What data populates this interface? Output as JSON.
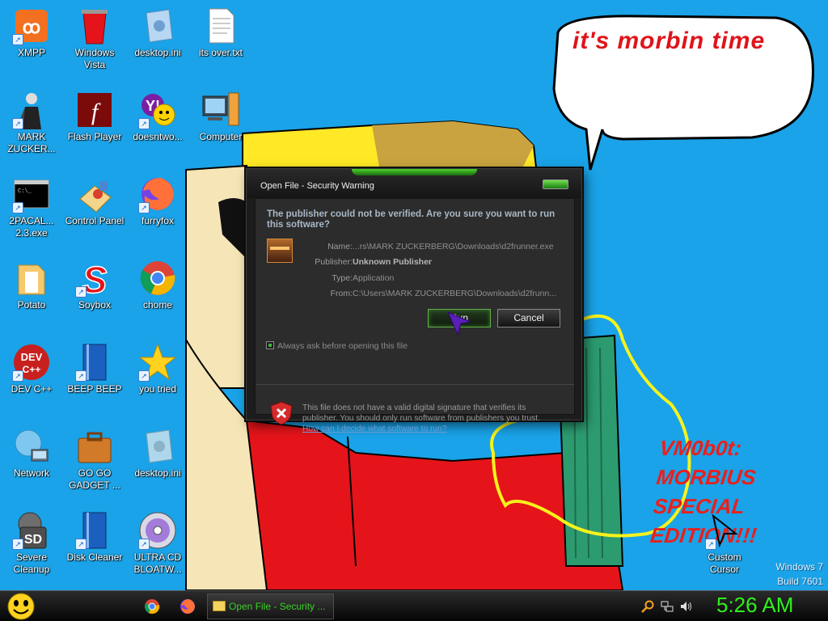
{
  "desktop": {
    "icons": [
      {
        "label": "XMPP"
      },
      {
        "label": "Windows Vista"
      },
      {
        "label": "desktop.ini"
      },
      {
        "label": "its over.txt"
      },
      {
        "label": "MARK ZUCKER..."
      },
      {
        "label": "Flash Player"
      },
      {
        "label": "doesntwo..."
      },
      {
        "label": "Computer"
      },
      {
        "label": "2PACAL... 2.3.exe"
      },
      {
        "label": "Control Panel"
      },
      {
        "label": "furryfox"
      },
      {
        "label": "Potato"
      },
      {
        "label": "Soybox"
      },
      {
        "label": "chome"
      },
      {
        "label": "DEV C++"
      },
      {
        "label": "BEEP BEEP"
      },
      {
        "label": "you tried"
      },
      {
        "label": "Network"
      },
      {
        "label": "GO GO GADGET ..."
      },
      {
        "label": "desktop.ini"
      },
      {
        "label": "Severe Cleanup"
      },
      {
        "label": "Disk Cleaner"
      },
      {
        "label": "ULTRA CD BLOATW..."
      },
      {
        "label": "Custom Cursor"
      }
    ]
  },
  "wallpaper": {
    "bubble_text": "it's morbin time",
    "caption_lines": [
      "VM0b0t:",
      "MORBIUS",
      "SPECIAL",
      "EDITION!!!"
    ],
    "build_line1": "Windows 7",
    "build_line2": "Build 7601"
  },
  "dialog": {
    "title": "Open File - Security Warning",
    "question": "The publisher could not be verified.  Are you sure you want to run this software?",
    "fields": [
      {
        "key": "Name:",
        "value": "...rs\\MARK ZUCKERBERG\\Downloads\\d2frunner.exe"
      },
      {
        "key": "Publisher:",
        "value": "Unknown Publisher"
      },
      {
        "key": "Type:",
        "value": "Application"
      },
      {
        "key": "From:",
        "value": "C:\\Users\\MARK ZUCKERBERG\\Downloads\\d2frunn..."
      }
    ],
    "run_label": "Run",
    "cancel_label": "Cancel",
    "checkbox_label": "Always ask before opening this file",
    "checkbox_checked": true,
    "warning_text": "This file does not have a valid digital signature that verifies its publisher.  You should only run software from publishers you trust.",
    "warning_link": "How can I decide what software to run?"
  },
  "taskbar": {
    "task_label": "Open File - Security ...",
    "clock": "5:26 AM",
    "accent_color": "#2ff01c"
  }
}
